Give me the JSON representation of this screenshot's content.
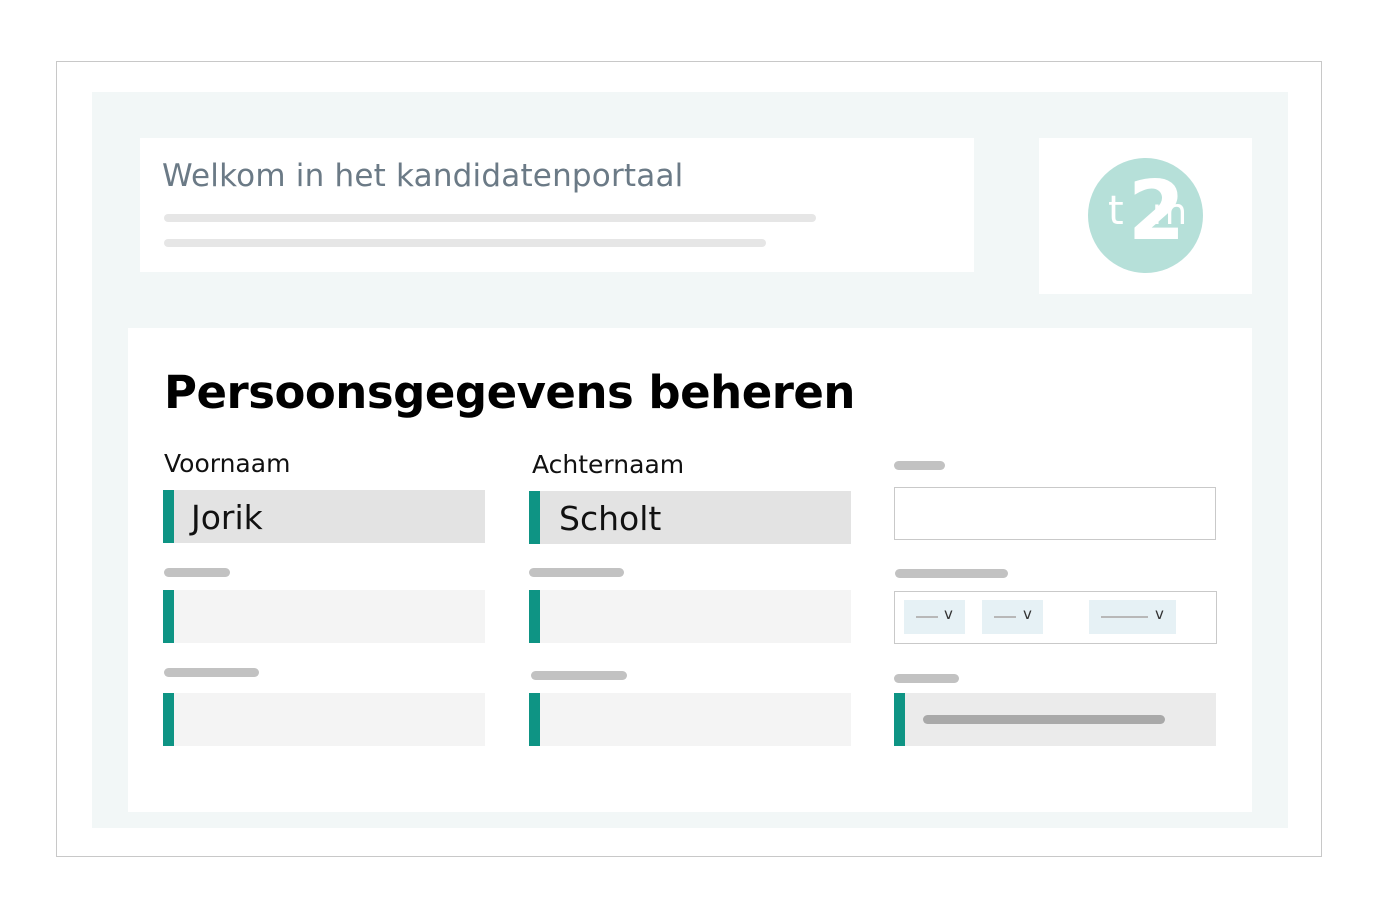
{
  "welcome": {
    "title": "Welkom in het kandidatenportaal"
  },
  "logo": {
    "letters": [
      "t",
      "2",
      "m"
    ],
    "color": "#b6e0d9"
  },
  "form": {
    "title": "Persoonsgegevens beheren",
    "first_name": {
      "label": "Voornaam",
      "value": "Jorik"
    },
    "last_name": {
      "label": "Achternaam",
      "value": "Scholt"
    }
  },
  "colors": {
    "accent": "#0e9484",
    "panel": "#f2f7f7"
  }
}
